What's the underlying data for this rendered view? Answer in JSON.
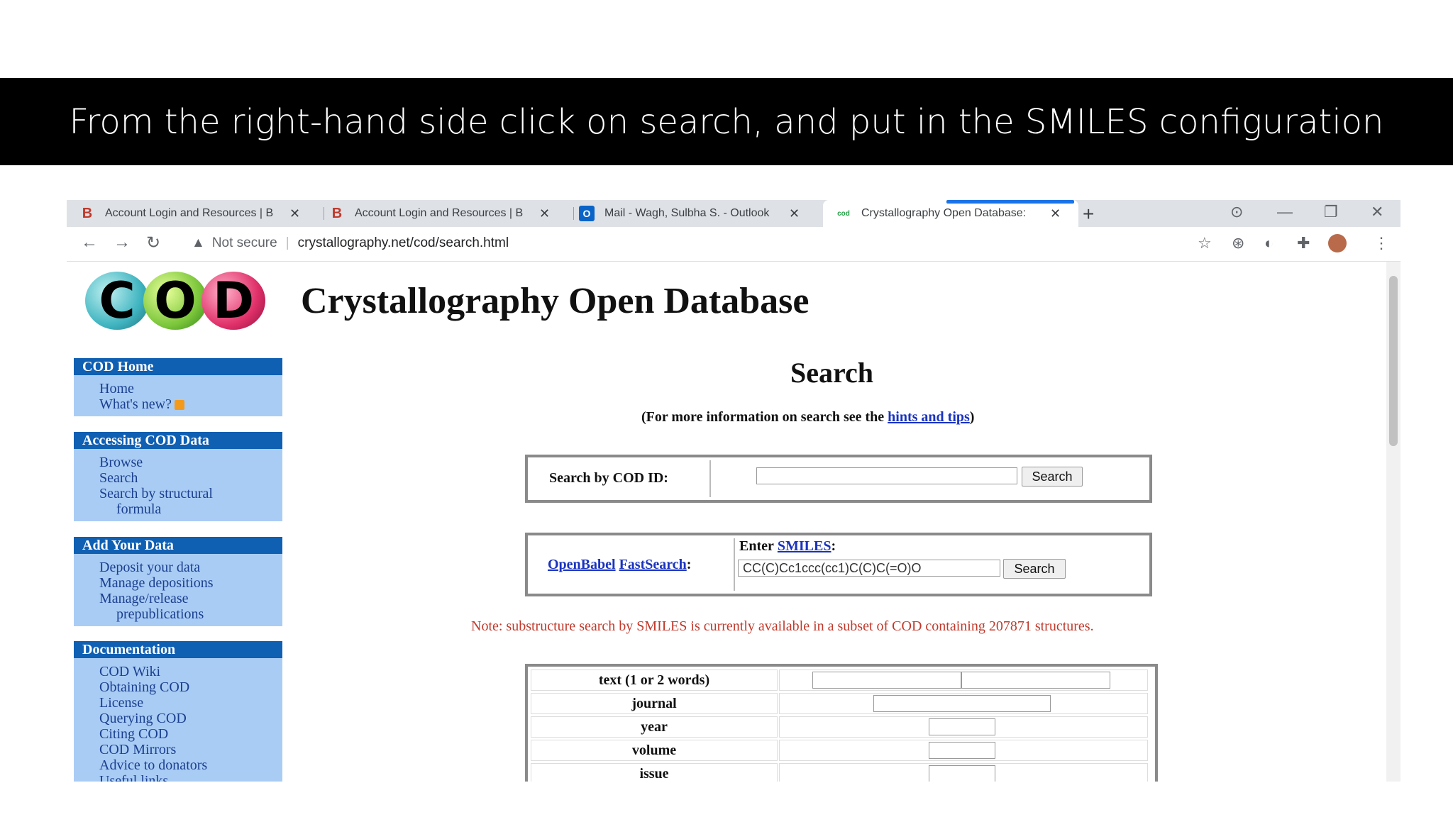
{
  "banner": "From the right-hand side click on search, and put in the SMILES configuration",
  "browser": {
    "tabs": [
      {
        "title": "Account Login and Resources | B",
        "favicon": "B"
      },
      {
        "title": "Account Login and Resources | B",
        "favicon": "B"
      },
      {
        "title": "Mail - Wagh, Sulbha S. - Outlook",
        "favicon": "O"
      },
      {
        "title": "Crystallography Open Database:",
        "favicon": "cod"
      }
    ],
    "new_tab": "+",
    "close_glyph": "✕",
    "security": "Not secure",
    "url": "crystallography.net/cod/search.html"
  },
  "site": {
    "logo_letters": [
      "C",
      "O",
      "D"
    ],
    "title": "Crystallography Open Database"
  },
  "sidebar": [
    {
      "header": "COD Home",
      "items": [
        "Home",
        "What's new?"
      ]
    },
    {
      "header": "Accessing COD Data",
      "items": [
        "Browse",
        "Search",
        "Search by structural",
        "formula"
      ]
    },
    {
      "header": "Add Your Data",
      "items": [
        "Deposit your data",
        "Manage depositions",
        "Manage/release",
        "prepublications"
      ]
    },
    {
      "header": "Documentation",
      "items": [
        "COD Wiki",
        "Obtaining COD",
        "License",
        "Querying COD",
        "Citing COD",
        "COD Mirrors",
        "Advice to donators",
        "Useful links"
      ]
    }
  ],
  "main": {
    "heading": "Search",
    "info_prefix": "(For more information on search see the ",
    "info_link": "hints and tips",
    "info_suffix": ")",
    "cod_id": {
      "label": "Search by COD ID:",
      "value": "",
      "button": "Search"
    },
    "smiles": {
      "link1": "OpenBabel",
      "link2": "FastSearch",
      "colon": ":",
      "enter_label": "Enter",
      "enter_link": "SMILES",
      "value": "CC(C)Cc1ccc(cc1)C(C)C(=O)O",
      "button": "Search"
    },
    "note": "Note: substructure search by SMILES is currently available in a subset of COD containing 207871 structures.",
    "fields": [
      "text (1 or 2 words)",
      "journal",
      "year",
      "volume",
      "issue"
    ]
  }
}
